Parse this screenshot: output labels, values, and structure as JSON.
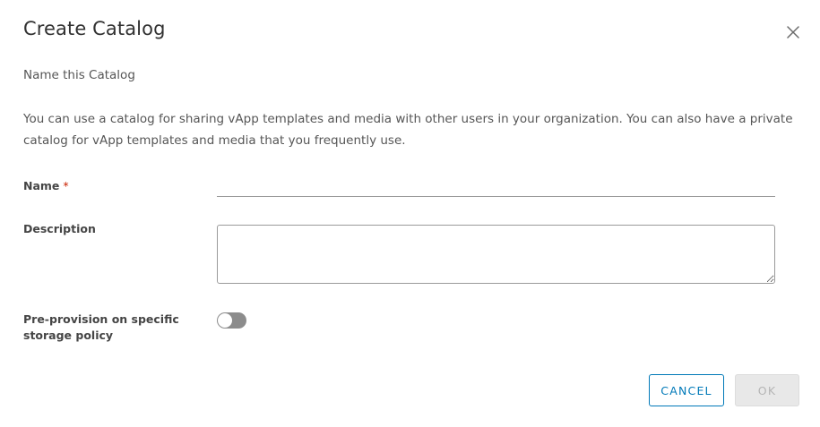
{
  "dialog": {
    "title": "Create Catalog",
    "subtitle": "Name this Catalog",
    "description": "You can use a catalog for sharing vApp templates and media with other users in your organization. You can also have a private catalog for vApp templates and media that you frequently use."
  },
  "form": {
    "name": {
      "label": "Name",
      "required_marker": "*",
      "value": ""
    },
    "description": {
      "label": "Description",
      "value": ""
    },
    "pre_provision": {
      "label": "Pre-provision on specific storage policy",
      "enabled": false
    }
  },
  "buttons": {
    "cancel": "CANCEL",
    "ok": "OK"
  },
  "icons": {
    "close": "close-icon"
  },
  "colors": {
    "primary": "#0079b8",
    "required": "#c92100",
    "toggle_off": "#8c8c8c",
    "disabled_bg": "#e8e8e8"
  }
}
